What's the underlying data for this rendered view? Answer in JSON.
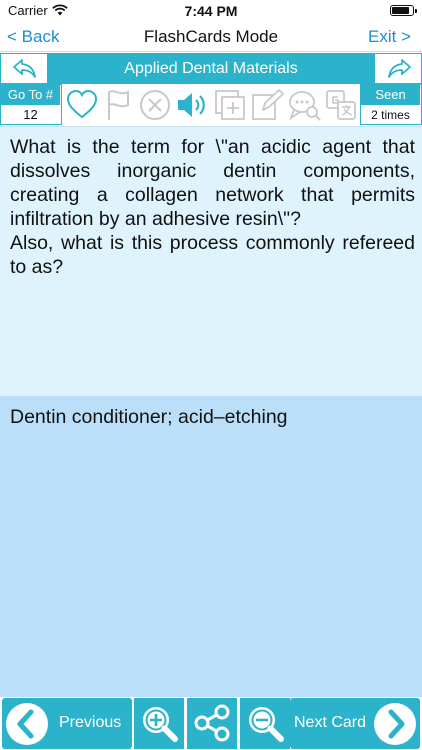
{
  "status_bar": {
    "carrier": "Carrier",
    "time": "7:44 PM",
    "battery_level": 0.92
  },
  "nav": {
    "back_label": "< Back",
    "title": "FlashCards Mode",
    "exit_label": "Exit >"
  },
  "category_title": "Applied Dental Materials",
  "goto": {
    "label": "Go To #",
    "value": "12"
  },
  "seen": {
    "label": "Seen",
    "value": "2 times"
  },
  "toolbar_icons": [
    "heart-icon",
    "flag-icon",
    "close-circle-icon",
    "speaker-icon",
    "add-card-icon",
    "edit-icon",
    "comment-search-icon",
    "translate-icon"
  ],
  "card": {
    "question": "What is the term for \\\"an acidic agent that dissolves inorganic dentin components, creating a collagen network that permits infiltration by an adhesive resin\\\"?\n  Also, what is this process commonly refereed to as?",
    "answer": "Dentin conditioner; acid–etching"
  },
  "bottom": {
    "previous_label": "Previous",
    "next_label": "Next Card"
  },
  "colors": {
    "accent": "#2bb3cc",
    "link": "#1a8fd6",
    "question_bg": "#dff3fd",
    "answer_bg": "#bcdff9"
  }
}
